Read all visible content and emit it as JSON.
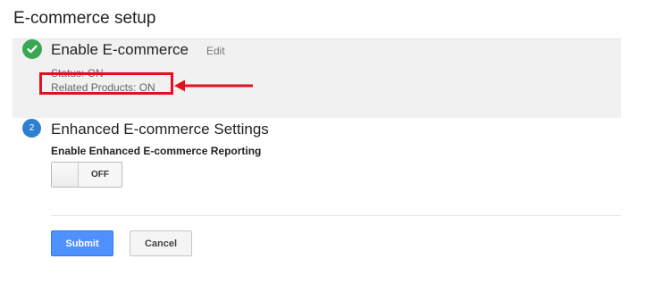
{
  "page": {
    "title": "E-commerce setup"
  },
  "step1": {
    "title": "Enable E-commerce",
    "edit_label": "Edit",
    "status_line": "Status: ON",
    "related_products_line": "Related Products: ON",
    "icon": "checkmark-icon"
  },
  "step2": {
    "number": "2",
    "title": "Enhanced E-commerce Settings",
    "setting_label": "Enable Enhanced E-commerce Reporting",
    "toggle_label": "OFF",
    "toggle_on": false
  },
  "actions": {
    "submit_label": "Submit",
    "cancel_label": "Cancel"
  },
  "colors": {
    "success": "#3aa757",
    "step_number": "#2c7fd1",
    "primary_button": "#4d90fe",
    "annotation": "#e3101f"
  }
}
